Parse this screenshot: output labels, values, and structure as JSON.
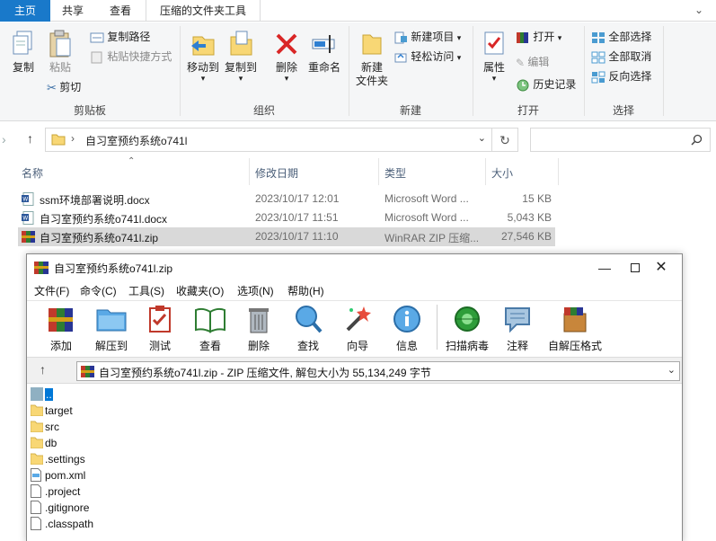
{
  "explorer": {
    "tabs": [
      {
        "label": "主页",
        "active": true
      },
      {
        "label": "共享"
      },
      {
        "label": "查看"
      },
      {
        "label": "压缩的文件夹工具"
      }
    ],
    "ribbon": {
      "clipboard": {
        "pin_label": "",
        "copy_label": "复制",
        "paste_label": "粘贴",
        "copy_path": "复制路径",
        "paste_shortcut": "粘贴快捷方式",
        "cut": "剪切",
        "group": "剪贴板"
      },
      "organize": {
        "move_to": "移动到",
        "copy_to": "复制到",
        "delete": "删除",
        "rename": "重命名",
        "group": "组织"
      },
      "new": {
        "new_folder": "新建",
        "new_folder_2": "文件夹",
        "new_item": "新建项目",
        "easy_access": "轻松访问",
        "group": "新建"
      },
      "open": {
        "properties": "属性",
        "open": "打开",
        "edit": "编辑",
        "history": "历史记录",
        "group": "打开"
      },
      "select": {
        "select_all": "全部选择",
        "select_none": "全部取消",
        "invert": "反向选择",
        "group": "选择"
      }
    },
    "address": {
      "path": "自习室预约系统o741l"
    },
    "columns": {
      "name": "名称",
      "date": "修改日期",
      "type": "类型",
      "size": "大小"
    },
    "files": [
      {
        "name": "ssm环境部署说明.docx",
        "date": "2023/10/17 12:01",
        "type": "Microsoft Word ...",
        "size": "15 KB",
        "icon": "word-doc-icon"
      },
      {
        "name": "自习室预约系统o741l.docx",
        "date": "2023/10/17 11:51",
        "type": "Microsoft Word ...",
        "size": "5,043 KB",
        "icon": "word-doc-icon"
      },
      {
        "name": "自习室预约系统o741l.zip",
        "date": "2023/10/17 11:10",
        "type": "WinRAR ZIP 压缩...",
        "size": "27,546 KB",
        "icon": "winrar-archive-icon",
        "selected": true
      }
    ]
  },
  "winrar": {
    "title": "自习室预约系统o741l.zip",
    "menu": [
      "文件(F)",
      "命令(C)",
      "工具(S)",
      "收藏夹(O)",
      "选项(N)",
      "帮助(H)"
    ],
    "toolbar": [
      "添加",
      "解压到",
      "测试",
      "查看",
      "删除",
      "查找",
      "向导",
      "信息",
      "扫描病毒",
      "注释",
      "自解压格式"
    ],
    "path": "自习室预约系统o741l.zip - ZIP 压缩文件, 解包大小为 55,134,249 字节",
    "entries": [
      {
        "name": "..",
        "kind": "parent",
        "selected": true
      },
      {
        "name": "target",
        "kind": "folder"
      },
      {
        "name": "src",
        "kind": "folder"
      },
      {
        "name": "db",
        "kind": "folder"
      },
      {
        "name": ".settings",
        "kind": "folder"
      },
      {
        "name": "pom.xml",
        "kind": "xml"
      },
      {
        "name": ".project",
        "kind": "file"
      },
      {
        "name": ".gitignore",
        "kind": "file"
      },
      {
        "name": ".classpath",
        "kind": "file"
      }
    ]
  },
  "colors": {
    "accent": "#1979ca",
    "selection": "#d9d9d9",
    "folder": "#f8d775",
    "delete_red": "#d92626"
  }
}
